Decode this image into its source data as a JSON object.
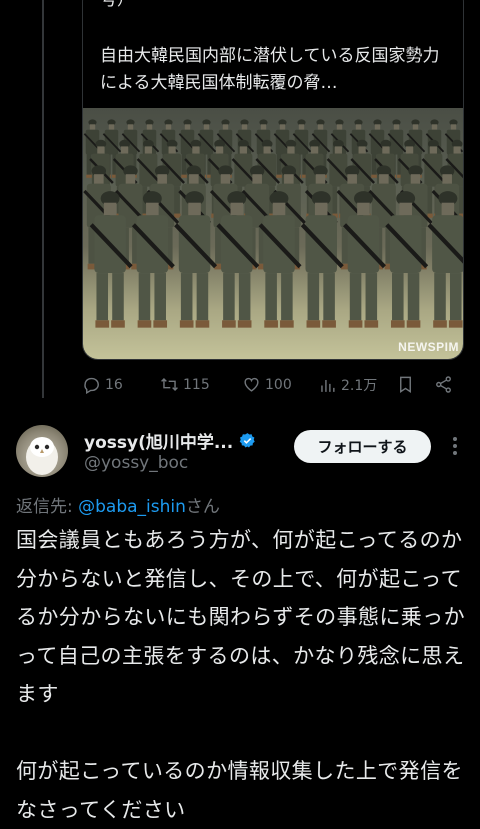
{
  "quoted_tweet": {
    "top_text": "号）",
    "body_text": "自由大韓民国内部に潜伏している反国家勢力による大韓民国体制転覆の脅…",
    "media_watermark": "NEWSPIM"
  },
  "actions": {
    "replies": "16",
    "retweets": "115",
    "likes": "100",
    "views": "2.1万",
    "icons": [
      "reply-icon",
      "retweet-icon",
      "like-icon",
      "views-icon",
      "bookmark-icon",
      "share-icon"
    ]
  },
  "reply": {
    "display_name": "yossy(旭川中学...",
    "handle": "@yossy_boc",
    "follow_label": "フォローする",
    "reply_prefix": "返信先: ",
    "reply_mention": "@baba_ishin",
    "reply_suffix": "さん",
    "body": "国会議員ともあろう方が、何が起こってるのか分からないと発信し、その上で、何が起こってるか分からないにも関わらずその事態に乗っかって自己の主張をするのは、かなり残念に思えます\n\n何が起こっているのか情報収集した上で発信をなさってください"
  },
  "colors": {
    "background": "#000000",
    "text": "#e7e9ea",
    "muted": "#71767b",
    "link": "#1d9bf0",
    "verified": "#1d9bf0",
    "follow_bg": "#eff3f4"
  }
}
